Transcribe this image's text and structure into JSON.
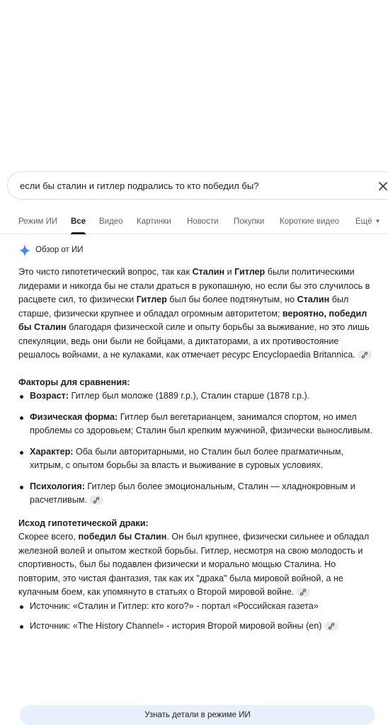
{
  "search": {
    "query": "если бы сталин и гитлер подрались то кто победил бы?"
  },
  "tabs": [
    {
      "label": "Режим ИИ"
    },
    {
      "label": "Все"
    },
    {
      "label": "Видео"
    },
    {
      "label": "Картинки"
    },
    {
      "label": "Новости"
    },
    {
      "label": "Покупки"
    },
    {
      "label": "Короткие видео"
    },
    {
      "label": "Ещё"
    }
  ],
  "active_tab": "Все",
  "ai_overview": {
    "header": "Обзор от ИИ",
    "intro": {
      "t1": "Это чисто гипотетический вопрос, так как ",
      "b1": "Сталин",
      "t2": " и ",
      "b2": "Гитлер",
      "t3": " были политическими лидерами и никогда бы не стали драться в рукопашную, но если бы это случилось в расцвете сил, то физически ",
      "b3": "Гитлер",
      "t4": " был бы более подтянутым, но ",
      "b4": "Сталин",
      "t5": " был старше, физически крупнее и обладал огромным авторитетом; ",
      "b5": "вероятно, победил бы Сталин",
      "t6": " благодаря физической силе и опыту борьбы за выживание, но это лишь спекуляции, ведь они были не бойцами, а диктаторами, а их противостояние решалось войнами, а не кулаками, как отмечает ресурс Encyclopaedia Britannica."
    },
    "factors_title": "Факторы для сравнения:",
    "factors": [
      {
        "label": "Возраст:",
        "text": " Гитлер был моложе (1889 г.р.), Сталин старше (1878 г.р.)."
      },
      {
        "label": "Физическая форма:",
        "text": " Гитлер был вегетарианцем, занимался спортом, но имел проблемы со здоровьем; Сталин был крепким мужчиной, физически выносливым."
      },
      {
        "label": "Характер:",
        "text": " Оба были авторитарными, но Сталин был более прагматичным, хитрым, с опытом борьбы за власть и выживание в суровых условиях."
      },
      {
        "label": "Психология:",
        "text": " Гитлер был более эмоциональным, Сталин — хладнокровным и расчетливым."
      }
    ],
    "outcome_title": "Исход гипотетической драки:",
    "outcome": {
      "t1": "Скорее всего, ",
      "b1": "победил бы Сталин",
      "t2": ". Он был крупнее, физически сильнее и обладал железной волей и опытом жесткой борьбы. Гитлер, несмотря на свою молодость и спортивность, был бы подавлен физически и морально мощью Сталина. Но повторим, это чистая фантазия, так как их \"драка\" была мировой войной, а не кулачным боем, как упомянуто в статьях о Второй мировой войне."
    },
    "sources": [
      {
        "text": "Источник: «Сталин и Гитлер: кто кого?» - портал «Российская газета»"
      },
      {
        "text": "Источник: «The History Channel» - история Второй мировой войны (en)"
      }
    ],
    "cta": "Узнать детали в режиме ИИ"
  },
  "colors": {
    "accent_blue": "#4285f4",
    "chip_bg": "#e8eaed",
    "cta_bg": "#e8f0fe"
  }
}
